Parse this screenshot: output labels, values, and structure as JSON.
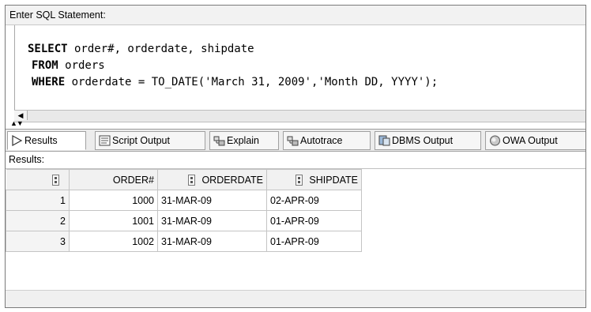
{
  "statement_label": "Enter SQL Statement:",
  "sql": {
    "line1": {
      "keyword": "SELECT",
      "rest": " order#, orderdate, shipdate"
    },
    "line2": {
      "keyword": "FROM",
      "rest": " orders"
    },
    "line3": {
      "keyword": "WHERE",
      "rest": " orderdate = TO_DATE('March 31, 2009','Month DD, YYYY');"
    }
  },
  "tabs": [
    {
      "label": "Results",
      "icon": "play-icon"
    },
    {
      "label": "Script Output",
      "icon": "script-icon"
    },
    {
      "label": "Explain",
      "icon": "explain-icon"
    },
    {
      "label": "Autotrace",
      "icon": "autotrace-icon"
    },
    {
      "label": "DBMS Output",
      "icon": "dbms-icon"
    },
    {
      "label": "OWA Output",
      "icon": "owa-icon"
    }
  ],
  "results_label": "Results:",
  "grid": {
    "columns": [
      "ORDER#",
      "ORDERDATE",
      "SHIPDATE"
    ],
    "rows": [
      {
        "n": "1",
        "order": "1000",
        "orderdate": "31-MAR-09",
        "shipdate": "02-APR-09"
      },
      {
        "n": "2",
        "order": "1001",
        "orderdate": "31-MAR-09",
        "shipdate": "01-APR-09"
      },
      {
        "n": "3",
        "order": "1002",
        "orderdate": "31-MAR-09",
        "shipdate": "01-APR-09"
      }
    ]
  }
}
